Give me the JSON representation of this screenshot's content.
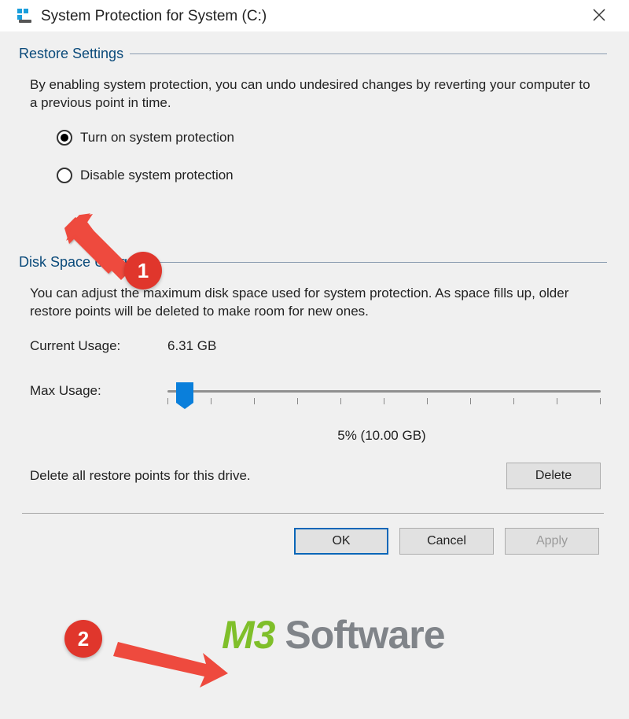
{
  "window": {
    "title": "System Protection for System (C:)"
  },
  "restore": {
    "section_label": "Restore Settings",
    "description": "By enabling system protection, you can undo undesired changes by reverting your computer to a previous point in time.",
    "option_on": "Turn on system protection",
    "option_off": "Disable system protection"
  },
  "disk": {
    "section_label": "Disk Space Usage",
    "description": "You can adjust the maximum disk space used for system protection. As space fills up, older restore points will be deleted to make room for new ones.",
    "current_label": "Current Usage:",
    "current_value": "6.31 GB",
    "max_label": "Max Usage:",
    "usage_line": "5% (10.00 GB)",
    "delete_text": "Delete all restore points for this drive.",
    "delete_button": "Delete"
  },
  "buttons": {
    "ok": "OK",
    "cancel": "Cancel",
    "apply": "Apply"
  },
  "annotations": {
    "badge1": "1",
    "badge2": "2"
  },
  "watermark": {
    "part1": "M3",
    "part2": " Software"
  }
}
